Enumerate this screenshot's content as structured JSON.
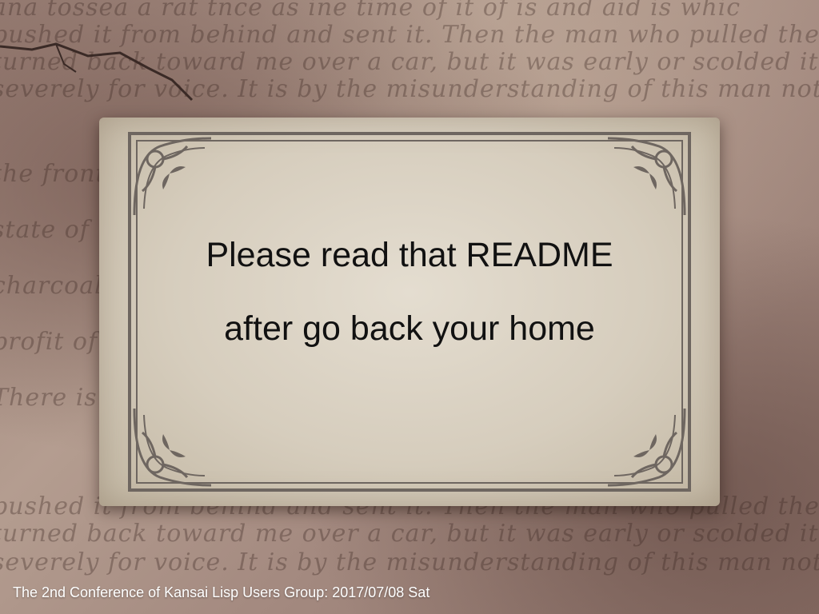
{
  "slide": {
    "message_line1": "Please read that README",
    "message_line2": "after go back your home",
    "footer": "The 2nd Conference of Kansai Lisp Users Group: 2017/07/08 Sat"
  },
  "colors": {
    "card": "#d6cdbd",
    "frame": "#6e6660",
    "text": "#111111",
    "footer_text": "#ffffff"
  }
}
